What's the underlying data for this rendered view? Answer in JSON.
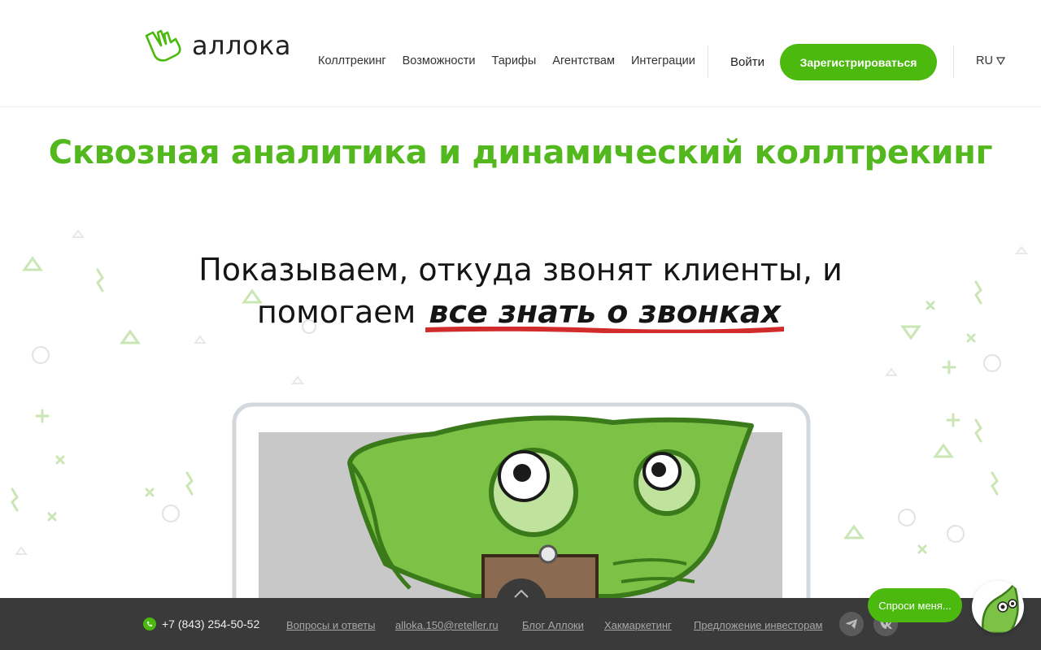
{
  "brand": {
    "name": "аллока"
  },
  "nav": {
    "items": [
      {
        "label": "Коллтрекинг"
      },
      {
        "label": "Возможности"
      },
      {
        "label": "Тарифы"
      },
      {
        "label": "Агентствам"
      },
      {
        "label": "Интеграции"
      }
    ],
    "login_label": "Войти",
    "register_label": "Зарегистрироваться",
    "lang_label": "RU"
  },
  "hero": {
    "title": "Сквозная аналитика и динамический коллтрекинг",
    "tagline_line1": "Показываем, откуда звонят клиенты, и",
    "tagline_line2_prefix": "помогаем",
    "tagline_accent": "все знать о звонках"
  },
  "footer": {
    "phone": "+7 (843) 254-50-52",
    "links": [
      {
        "label": "Вопросы и ответы"
      },
      {
        "label": "alloka.150@reteller.ru"
      },
      {
        "label": "Блог Аллоки"
      },
      {
        "label": "Хакмаркетинг"
      },
      {
        "label": "Предложение инвесторам"
      }
    ],
    "social": [
      "telegram-icon",
      "vk-icon"
    ]
  },
  "chat": {
    "label": "Спроси меня..."
  },
  "colors": {
    "brand_green": "#4cb90f",
    "title_green": "#52b81d",
    "footer_bg": "#3a3a3a",
    "accent_red": "#d22b2b"
  }
}
